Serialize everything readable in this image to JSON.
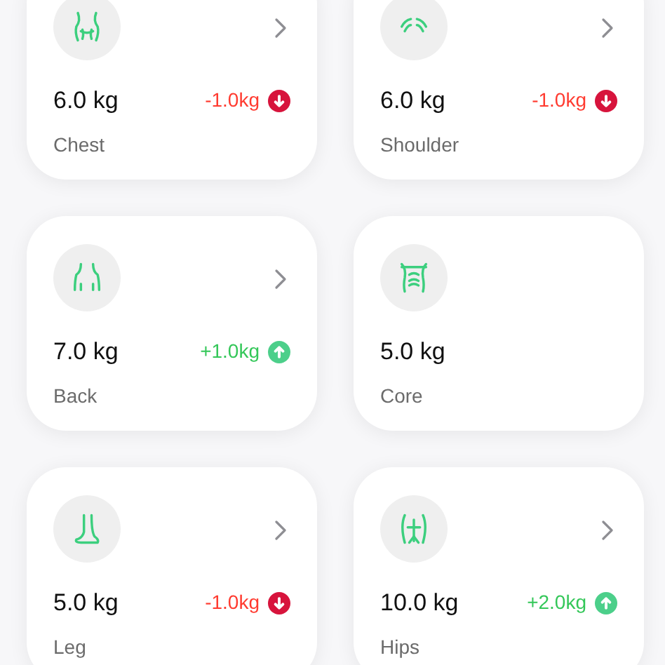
{
  "cards": [
    {
      "weight": "6.0 kg",
      "name": "Chest",
      "chevron": true,
      "change": {
        "text": "-1.0kg",
        "kind": "decrease"
      }
    },
    {
      "weight": "6.0 kg",
      "name": "Shoulder",
      "chevron": true,
      "change": {
        "text": "-1.0kg",
        "kind": "decrease"
      }
    },
    {
      "weight": "7.0 kg",
      "name": "Back",
      "chevron": true,
      "change": {
        "text": "+1.0kg",
        "kind": "increase"
      }
    },
    {
      "weight": "5.0 kg",
      "name": "Core",
      "chevron": false
    },
    {
      "weight": "5.0 kg",
      "name": "Leg",
      "chevron": true,
      "change": {
        "text": "-1.0kg",
        "kind": "decrease"
      }
    },
    {
      "weight": "10.0 kg",
      "name": "Hips",
      "chevron": true,
      "change": {
        "text": "+2.0kg",
        "kind": "increase"
      }
    }
  ]
}
